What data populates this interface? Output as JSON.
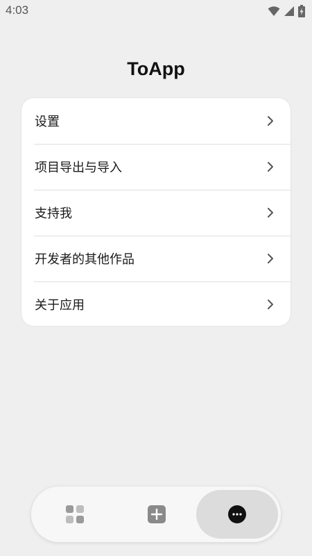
{
  "status_bar": {
    "time": "4:03"
  },
  "app": {
    "title": "ToApp"
  },
  "menu": {
    "items": [
      {
        "label": "设置"
      },
      {
        "label": "项目导出与导入"
      },
      {
        "label": "支持我"
      },
      {
        "label": "开发者的其他作品"
      },
      {
        "label": "关于应用"
      }
    ]
  },
  "bottom_nav": {
    "items": [
      {
        "icon": "grid-icon",
        "selected": false
      },
      {
        "icon": "plus-square-icon",
        "selected": false
      },
      {
        "icon": "more-dots-icon",
        "selected": true
      }
    ]
  },
  "colors": {
    "background": "#efefef",
    "card": "#ffffff",
    "selected_pill": "#dcdcdc",
    "icon_dark": "#111111",
    "icon_gray": "#8a8a8a"
  }
}
